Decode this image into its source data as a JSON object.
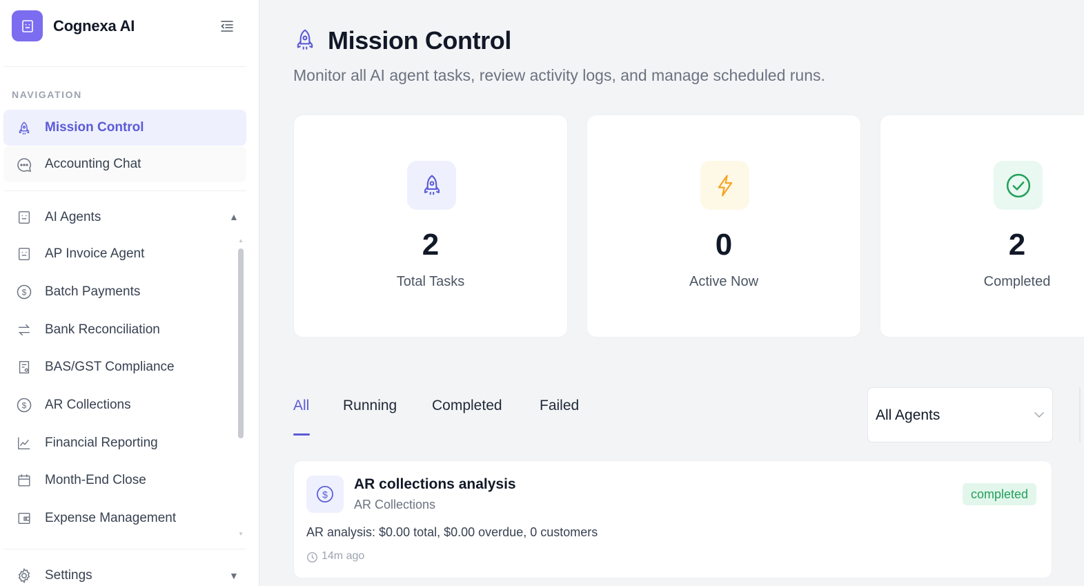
{
  "brand": {
    "name": "Cognexa AI",
    "logo_icon": "robot-icon",
    "accent": "#7c6cf0"
  },
  "sidebar": {
    "section_label": "NAVIGATION",
    "primary_items": [
      {
        "label": "Mission Control",
        "icon": "rocket-icon",
        "active": true
      },
      {
        "label": "Accounting Chat",
        "icon": "chat-bubble-icon",
        "active": false
      }
    ],
    "agents_group": {
      "label": "AI Agents",
      "icon": "robot-icon",
      "expanded": true,
      "items": [
        {
          "label": "AP Invoice Agent",
          "icon": "robot-icon"
        },
        {
          "label": "Batch Payments",
          "icon": "dollar-circle-icon"
        },
        {
          "label": "Bank Reconciliation",
          "icon": "arrows-swap-icon"
        },
        {
          "label": "BAS/GST Compliance",
          "icon": "document-receipt-icon"
        },
        {
          "label": "AR Collections",
          "icon": "dollar-circle-icon"
        },
        {
          "label": "Financial Reporting",
          "icon": "line-chart-icon"
        },
        {
          "label": "Month-End Close",
          "icon": "calendar-icon"
        },
        {
          "label": "Expense Management",
          "icon": "wallet-icon"
        }
      ]
    },
    "settings": {
      "label": "Settings",
      "icon": "gear-icon",
      "expanded": false
    }
  },
  "header": {
    "title": "Mission Control",
    "subtitle": "Monitor all AI agent tasks, review activity logs, and manage scheduled runs."
  },
  "stats": [
    {
      "value": "2",
      "label": "Total Tasks",
      "icon": "rocket-icon",
      "color": "#5b5bd6",
      "bg": "#eef0fe"
    },
    {
      "value": "0",
      "label": "Active Now",
      "icon": "lightning-icon",
      "color": "#f5a524",
      "bg": "#fef9e7"
    },
    {
      "value": "2",
      "label": "Completed",
      "icon": "check-circle-icon",
      "color": "#22a05b",
      "bg": "#e9f8f0"
    }
  ],
  "tabs": [
    {
      "label": "All",
      "active": true
    },
    {
      "label": "Running",
      "active": false
    },
    {
      "label": "Completed",
      "active": false
    },
    {
      "label": "Failed",
      "active": false
    }
  ],
  "agent_filter": {
    "selected": "All Agents"
  },
  "tasks": [
    {
      "title": "AR collections analysis",
      "agent": "AR Collections",
      "status": "completed",
      "description": "AR analysis: $0.00 total, $0.00 overdue, 0 customers",
      "time": "14m ago",
      "icon": "dollar-circle-icon"
    }
  ]
}
